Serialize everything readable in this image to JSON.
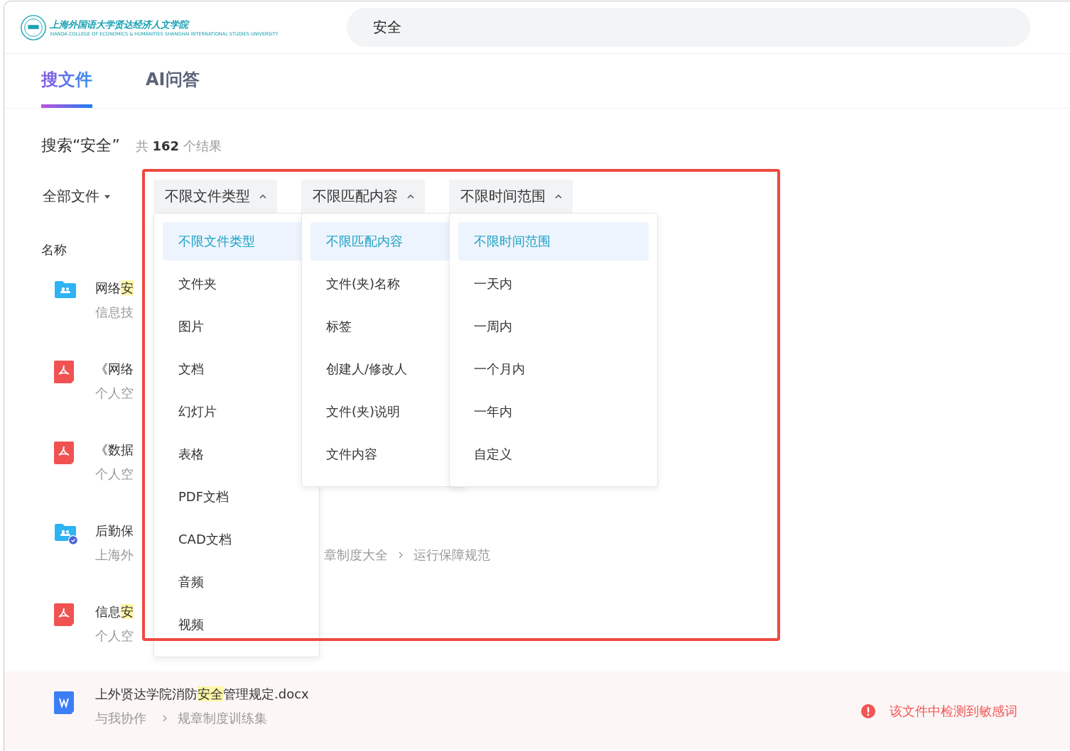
{
  "header": {
    "logo": {
      "title": "上海外国语大学贤达经济人文学院",
      "subtitle": "XIANDA COLLEGE OF ECONOMICS & HUMANITIES SHANGHAI INTERNATIONAL STUDIES UNIVERSITY"
    },
    "search": {
      "value": "安全"
    }
  },
  "tabs": [
    {
      "label": "搜文件",
      "selected": true
    },
    {
      "label": "AI问答",
      "selected": false
    }
  ],
  "summary": {
    "query": "搜索“安全”",
    "prefix": "共",
    "count": "162",
    "suffix": "个结果"
  },
  "scope": {
    "label": "全部文件"
  },
  "filters": [
    {
      "label": "不限文件类型",
      "expanded": true,
      "options": [
        {
          "label": "不限文件类型",
          "selected": true
        },
        {
          "label": "文件夹",
          "selected": false
        },
        {
          "label": "图片",
          "selected": false
        },
        {
          "label": "文档",
          "selected": false
        },
        {
          "label": "幻灯片",
          "selected": false
        },
        {
          "label": "表格",
          "selected": false
        },
        {
          "label": "PDF文档",
          "selected": false
        },
        {
          "label": "CAD文档",
          "selected": false
        },
        {
          "label": "音频",
          "selected": false
        },
        {
          "label": "视频",
          "selected": false
        }
      ]
    },
    {
      "label": "不限匹配内容",
      "expanded": true,
      "options": [
        {
          "label": "不限匹配内容",
          "selected": true
        },
        {
          "label": "文件(夹)名称",
          "selected": false
        },
        {
          "label": "标签",
          "selected": false
        },
        {
          "label": "创建人/修改人",
          "selected": false
        },
        {
          "label": "文件(夹)说明",
          "selected": false
        },
        {
          "label": "文件内容",
          "selected": false
        }
      ]
    },
    {
      "label": "不限时间范围",
      "expanded": true,
      "options": [
        {
          "label": "不限时间范围",
          "selected": true
        },
        {
          "label": "一天内",
          "selected": false
        },
        {
          "label": "一周内",
          "selected": false
        },
        {
          "label": "一个月内",
          "selected": false
        },
        {
          "label": "一年内",
          "selected": false
        },
        {
          "label": "自定义",
          "selected": false
        }
      ]
    }
  ],
  "list": {
    "column": "名称",
    "rows": [
      {
        "kind": "shared-folder",
        "title": [
          {
            "text": "网络",
            "hit": false
          },
          {
            "text": "安",
            "hit": true
          }
        ],
        "path": "信息技",
        "path_more": [],
        "flagged": false
      },
      {
        "kind": "pdf",
        "title": [
          {
            "text": "《网络",
            "hit": false
          }
        ],
        "path": "个人空",
        "path_more": [],
        "flagged": false
      },
      {
        "kind": "pdf",
        "title": [
          {
            "text": "《数据",
            "hit": false
          }
        ],
        "path": "个人空",
        "path_more": [],
        "flagged": false
      },
      {
        "kind": "protected-folder",
        "title": [
          {
            "text": "后勤保",
            "hit": false
          }
        ],
        "path": "上海外",
        "path_more": [
          "章制度大全",
          "运行保障规范"
        ],
        "flagged": false
      },
      {
        "kind": "pdf",
        "title": [
          {
            "text": "信息",
            "hit": false
          },
          {
            "text": "安",
            "hit": true
          }
        ],
        "path": "个人空",
        "path_more": [],
        "flagged": false
      },
      {
        "kind": "word",
        "title": [
          {
            "text": "上外贤达学院消防",
            "hit": false
          },
          {
            "text": "安全",
            "hit": true
          },
          {
            "text": "管理规定.docx",
            "hit": false
          }
        ],
        "path": "与我协作",
        "path_more": [
          "规章制度训练集"
        ],
        "flagged": true,
        "warning": "该文件中检测到敏感词"
      }
    ]
  }
}
